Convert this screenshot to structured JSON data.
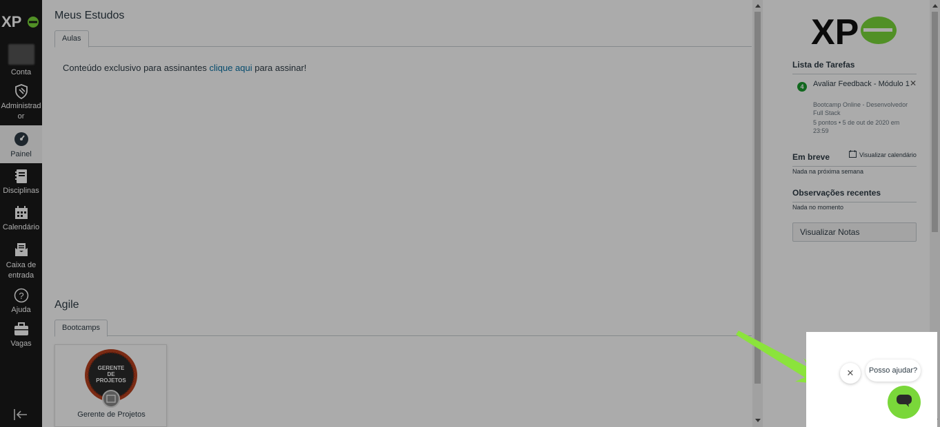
{
  "global_nav": {
    "logo_text": "XPe",
    "items": [
      {
        "label": "Conta",
        "icon": "avatar"
      },
      {
        "label": "Administrador",
        "icon": "shield-icon"
      },
      {
        "label": "Painel",
        "icon": "dashboard-icon",
        "active": true
      },
      {
        "label": "Disciplinas",
        "icon": "book-icon"
      },
      {
        "label": "Calendário",
        "icon": "calendar-icon"
      },
      {
        "label": "Caixa de entrada",
        "icon": "inbox-icon"
      },
      {
        "label": "Ajuda",
        "icon": "help-icon"
      },
      {
        "label": "Vagas",
        "icon": "briefcase-icon"
      }
    ],
    "collapse_icon": "collapse-nav-icon"
  },
  "main": {
    "section1": {
      "title": "Meus Estudos",
      "tab": "Aulas",
      "notice_before": "Conteúdo exclusivo para assinantes ",
      "notice_link": "clique aqui",
      "notice_after": " para assinar!"
    },
    "section2": {
      "title": "Agile",
      "tab": "Bootcamps",
      "cards": [
        {
          "name": "Gerente de Projetos",
          "badge_line1": "GERENTE",
          "badge_line2": "DE",
          "badge_line3": "PROJETOS"
        }
      ]
    }
  },
  "sidebar": {
    "brand": "XPe",
    "todo": {
      "heading": "Lista de Tarefas",
      "items": [
        {
          "count": "4",
          "title": "Avaliar Feedback - Módulo 1",
          "course": "Bootcamp Online - Desenvolvedor Full Stack",
          "meta": "5 pontos • 5 de out de 2020 em 23:59"
        }
      ]
    },
    "coming_up": {
      "heading": "Em breve",
      "calendar_link": "Visualizar calendário",
      "empty": "Nada na próxima semana"
    },
    "feedback": {
      "heading": "Observações recentes",
      "empty": "Nada no momento"
    },
    "grades_button": "Visualizar Notas"
  },
  "chat": {
    "prompt": "Posso ajudar?",
    "close_symbol": "✕"
  },
  "colors": {
    "nav_bg": "#1a1a1a",
    "accent_green": "#7ad73a",
    "link": "#0770a3",
    "todo_badge": "#1a9b2e"
  }
}
